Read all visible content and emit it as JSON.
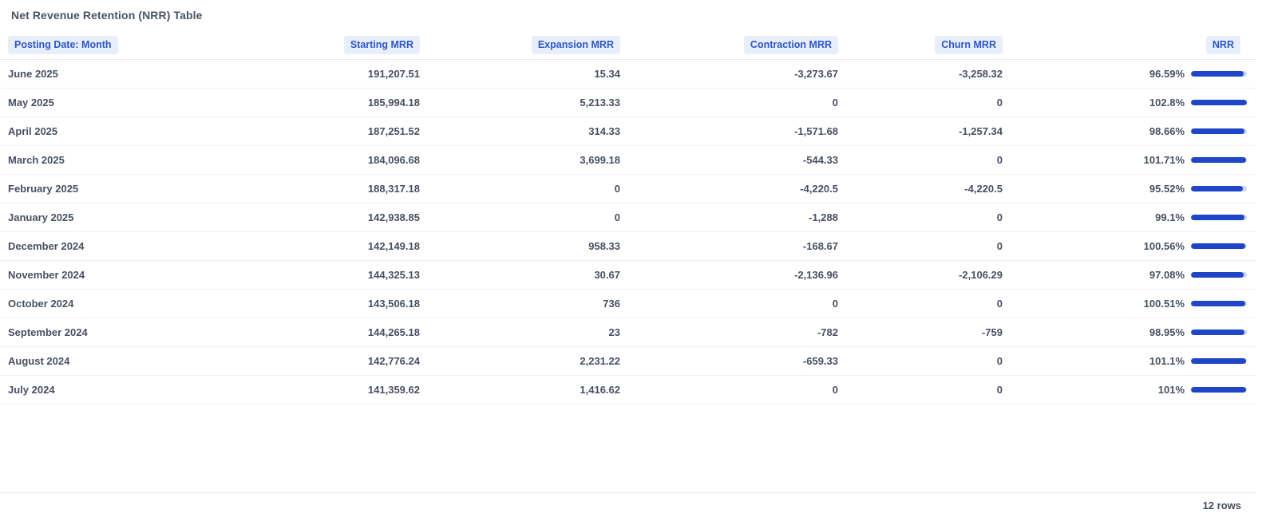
{
  "title": "Net Revenue Retention (NRR) Table",
  "colors": {
    "header_bg": "#e8eefb",
    "header_text": "#2d57c7",
    "bar_fill": "#1f46c7",
    "bar_track": "#c9d6f5"
  },
  "columns": [
    "Posting Date: Month",
    "Starting MRR",
    "Expansion MRR",
    "Contraction MRR",
    "Churn MRR",
    "NRR"
  ],
  "rows": [
    {
      "month": "June 2025",
      "starting": "191,207.51",
      "expansion": "15.34",
      "contraction": "-3,273.67",
      "churn": "-3,258.32",
      "nrr": "96.59%",
      "nrr_value": 96.59
    },
    {
      "month": "May 2025",
      "starting": "185,994.18",
      "expansion": "5,213.33",
      "contraction": "0",
      "churn": "0",
      "nrr": "102.8%",
      "nrr_value": 102.8
    },
    {
      "month": "April 2025",
      "starting": "187,251.52",
      "expansion": "314.33",
      "contraction": "-1,571.68",
      "churn": "-1,257.34",
      "nrr": "98.66%",
      "nrr_value": 98.66
    },
    {
      "month": "March 2025",
      "starting": "184,096.68",
      "expansion": "3,699.18",
      "contraction": "-544.33",
      "churn": "0",
      "nrr": "101.71%",
      "nrr_value": 101.71
    },
    {
      "month": "February 2025",
      "starting": "188,317.18",
      "expansion": "0",
      "contraction": "-4,220.5",
      "churn": "-4,220.5",
      "nrr": "95.52%",
      "nrr_value": 95.52
    },
    {
      "month": "January 2025",
      "starting": "142,938.85",
      "expansion": "0",
      "contraction": "-1,288",
      "churn": "0",
      "nrr": "99.1%",
      "nrr_value": 99.1
    },
    {
      "month": "December 2024",
      "starting": "142,149.18",
      "expansion": "958.33",
      "contraction": "-168.67",
      "churn": "0",
      "nrr": "100.56%",
      "nrr_value": 100.56
    },
    {
      "month": "November 2024",
      "starting": "144,325.13",
      "expansion": "30.67",
      "contraction": "-2,136.96",
      "churn": "-2,106.29",
      "nrr": "97.08%",
      "nrr_value": 97.08
    },
    {
      "month": "October 2024",
      "starting": "143,506.18",
      "expansion": "736",
      "contraction": "0",
      "churn": "0",
      "nrr": "100.51%",
      "nrr_value": 100.51
    },
    {
      "month": "September 2024",
      "starting": "144,265.18",
      "expansion": "23",
      "contraction": "-782",
      "churn": "-759",
      "nrr": "98.95%",
      "nrr_value": 98.95
    },
    {
      "month": "August 2024",
      "starting": "142,776.24",
      "expansion": "2,231.22",
      "contraction": "-659.33",
      "churn": "0",
      "nrr": "101.1%",
      "nrr_value": 101.1
    },
    {
      "month": "July 2024",
      "starting": "141,359.62",
      "expansion": "1,416.62",
      "contraction": "0",
      "churn": "0",
      "nrr": "101%",
      "nrr_value": 101
    }
  ],
  "nrr_bar_max": 102.8,
  "footer": {
    "row_count": "12 rows"
  }
}
